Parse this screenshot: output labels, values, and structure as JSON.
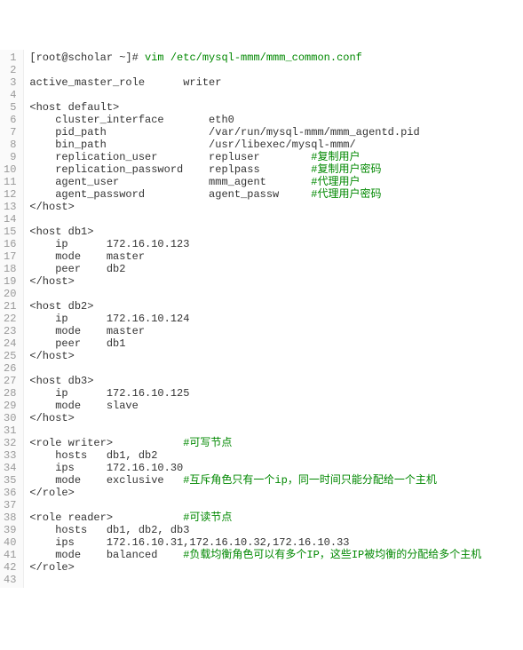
{
  "prompt_text": "[root@scholar ~]# ",
  "command": "vim /etc/mysql-mmm/mmm_common.conf",
  "lines": [
    {
      "n": 1,
      "kind": "cmd"
    },
    {
      "n": 2,
      "t": ""
    },
    {
      "n": 3,
      "t": "active_master_role      writer"
    },
    {
      "n": 4,
      "t": ""
    },
    {
      "n": 5,
      "t": "<host default>"
    },
    {
      "n": 6,
      "t": "    cluster_interface       eth0"
    },
    {
      "n": 7,
      "t": "    pid_path                /var/run/mysql-mmm/mmm_agentd.pid"
    },
    {
      "n": 8,
      "t": "    bin_path                /usr/libexec/mysql-mmm/"
    },
    {
      "n": 9,
      "t": "    replication_user        repluser        ",
      "c": "#复制用户"
    },
    {
      "n": 10,
      "t": "    replication_password    replpass        ",
      "c": "#复制用户密码"
    },
    {
      "n": 11,
      "t": "    agent_user              mmm_agent       ",
      "c": "#代理用户"
    },
    {
      "n": 12,
      "t": "    agent_password          agent_passw     ",
      "c": "#代理用户密码"
    },
    {
      "n": 13,
      "t": "</host>"
    },
    {
      "n": 14,
      "t": ""
    },
    {
      "n": 15,
      "t": "<host db1>"
    },
    {
      "n": 16,
      "t": "    ip      172.16.10.123"
    },
    {
      "n": 17,
      "t": "    mode    master"
    },
    {
      "n": 18,
      "t": "    peer    db2"
    },
    {
      "n": 19,
      "t": "</host>"
    },
    {
      "n": 20,
      "t": ""
    },
    {
      "n": 21,
      "t": "<host db2>"
    },
    {
      "n": 22,
      "t": "    ip      172.16.10.124"
    },
    {
      "n": 23,
      "t": "    mode    master"
    },
    {
      "n": 24,
      "t": "    peer    db1"
    },
    {
      "n": 25,
      "t": "</host>"
    },
    {
      "n": 26,
      "t": ""
    },
    {
      "n": 27,
      "t": "<host db3>"
    },
    {
      "n": 28,
      "t": "    ip      172.16.10.125"
    },
    {
      "n": 29,
      "t": "    mode    slave"
    },
    {
      "n": 30,
      "t": "</host>"
    },
    {
      "n": 31,
      "t": ""
    },
    {
      "n": 32,
      "t": "<role writer>           ",
      "c": "#可写节点"
    },
    {
      "n": 33,
      "t": "    hosts   db1, db2"
    },
    {
      "n": 34,
      "t": "    ips     172.16.10.30"
    },
    {
      "n": 35,
      "t": "    mode    exclusive   ",
      "c": "#互斥角色只有一个ip，同一时间只能分配给一个主机"
    },
    {
      "n": 36,
      "t": "</role>"
    },
    {
      "n": 37,
      "t": ""
    },
    {
      "n": 38,
      "t": "<role reader>           ",
      "c": "#可读节点"
    },
    {
      "n": 39,
      "t": "    hosts   db1, db2, db3"
    },
    {
      "n": 40,
      "t": "    ips     172.16.10.31,172.16.10.32,172.16.10.33"
    },
    {
      "n": 41,
      "t": "    mode    balanced    ",
      "c": "#负载均衡角色可以有多个IP，这些IP被均衡的分配给多个主机"
    },
    {
      "n": 42,
      "t": "</role>"
    },
    {
      "n": 43,
      "t": ""
    }
  ]
}
